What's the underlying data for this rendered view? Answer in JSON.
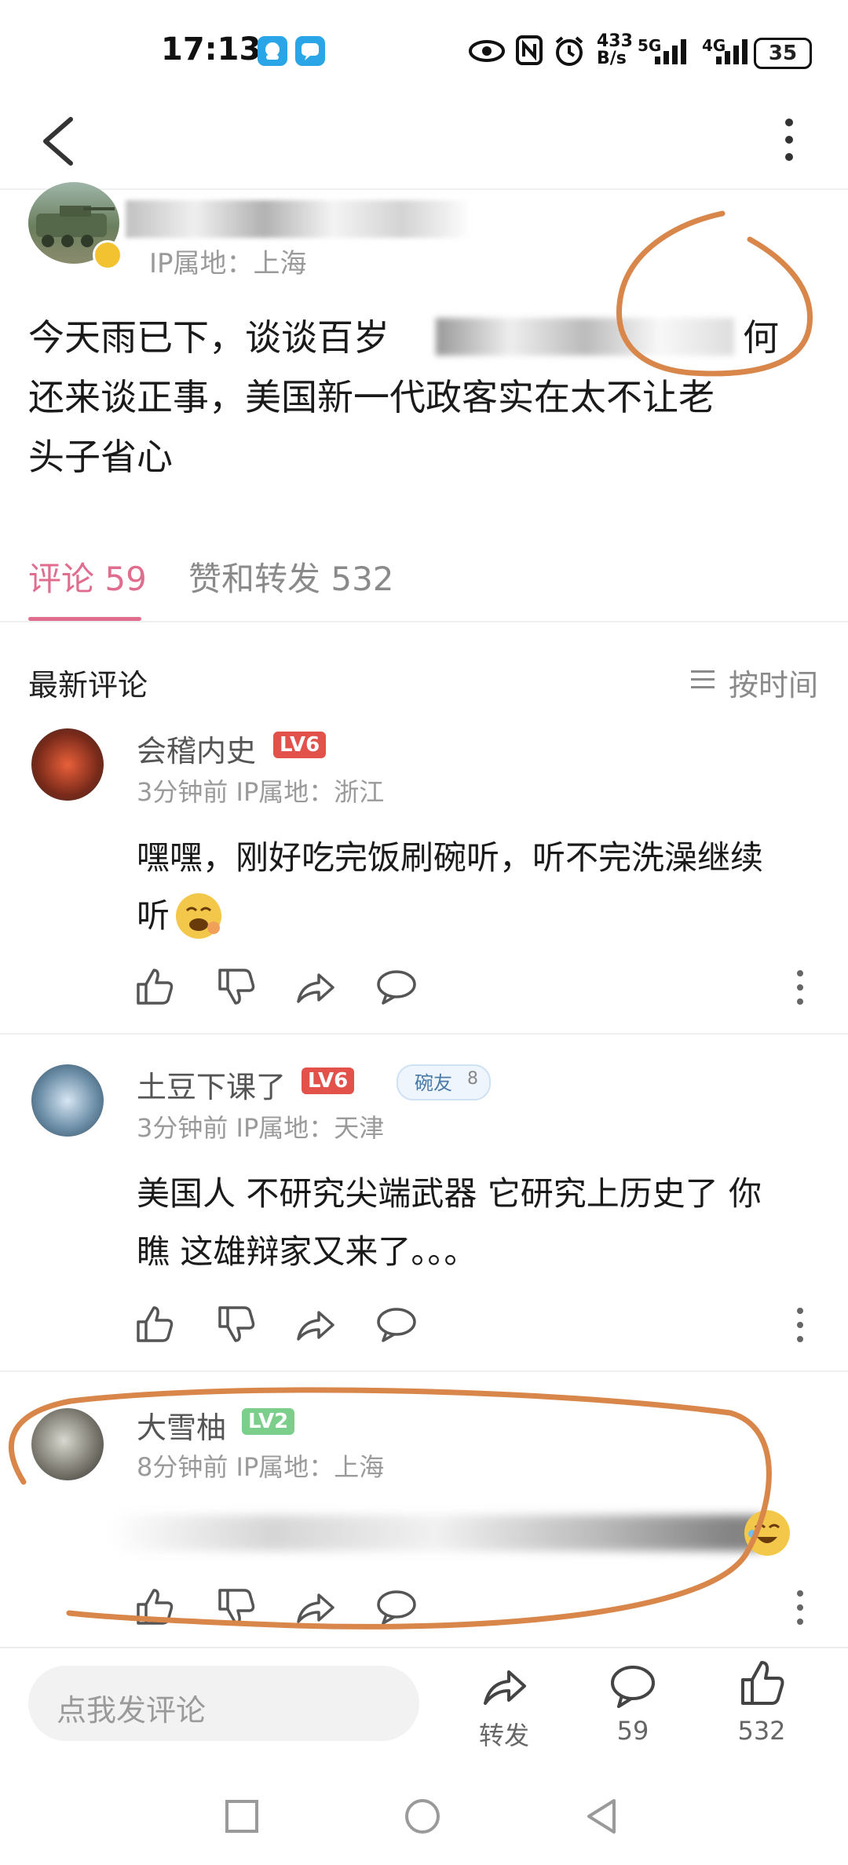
{
  "status_bar": {
    "time": "17:13",
    "net_speed_top": "433",
    "net_speed_bottom": "B/s",
    "signal1_label": "5G",
    "signal2_label": "4G",
    "battery": "35"
  },
  "post": {
    "ip_location": "IP属地：上海",
    "text_line1_a": "今天雨已下，谈谈百岁",
    "text_line1_b": "何",
    "text_line2": "还来谈正事，美国新一代政客实在太不让老",
    "text_line3": "头子省心"
  },
  "tabs": {
    "comments_label": "评论 59",
    "likes_reposts_label": "赞和转发 532"
  },
  "section": {
    "title": "最新评论",
    "sort_label": "按时间"
  },
  "comments": [
    {
      "name": "会稽内史",
      "level": "LV6",
      "meta": "3分钟前  IP属地：浙江",
      "body_line1": "嘿嘿，刚好吃完饭刷碗听，听不完洗澡继续",
      "body_line2": "听"
    },
    {
      "name": "土豆下课了",
      "level": "LV6",
      "badge_label": "碗友",
      "badge_level": "8",
      "meta": "3分钟前  IP属地：天津",
      "body_line1": "美国人 不研究尖端武器 它研究上历史了 你",
      "body_line2": "瞧 这雄辩家又来了。。。"
    },
    {
      "name": "大雪柚",
      "level": "LV2",
      "meta": "8分钟前  IP属地：上海"
    }
  ],
  "bottom_bar": {
    "input_placeholder": "点我发评论",
    "repost_label": "转发",
    "comment_count": "59",
    "like_count": "532"
  },
  "colors": {
    "accent_pink": "#e06d8e",
    "annotation_orange": "#d9864a",
    "lv6_red": "#e2524b",
    "lv2_green": "#7ccf8a"
  }
}
